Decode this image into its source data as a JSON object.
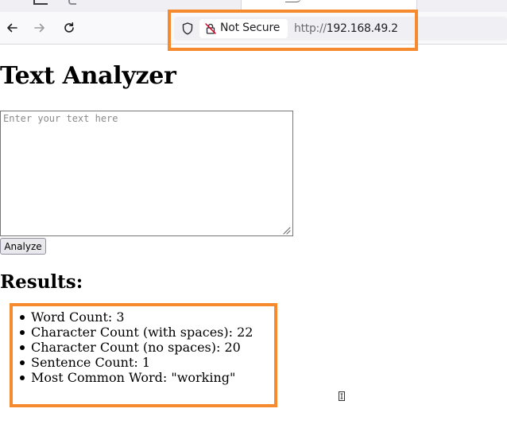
{
  "browser": {
    "security_label": "Not Secure",
    "url_scheme": "http://",
    "url_host": "192.168.49.2",
    "icons": {
      "back": "arrow-left-icon",
      "forward": "arrow-right-icon",
      "reload": "reload-icon",
      "tracking_protection": "shield-icon",
      "security": "broken-lock-icon"
    }
  },
  "page": {
    "title": "Text Analyzer",
    "input": {
      "placeholder": "Enter your text here",
      "value": ""
    },
    "analyze_button": "Analyze",
    "results_heading": "Results:",
    "results": [
      "Word Count: 3",
      "Character Count (with spaces): 22",
      "Character Count (no spaces): 20",
      "Sentence Count: 1",
      "Most Common Word: \"working\""
    ]
  },
  "annotation_color": "#f58a2f"
}
